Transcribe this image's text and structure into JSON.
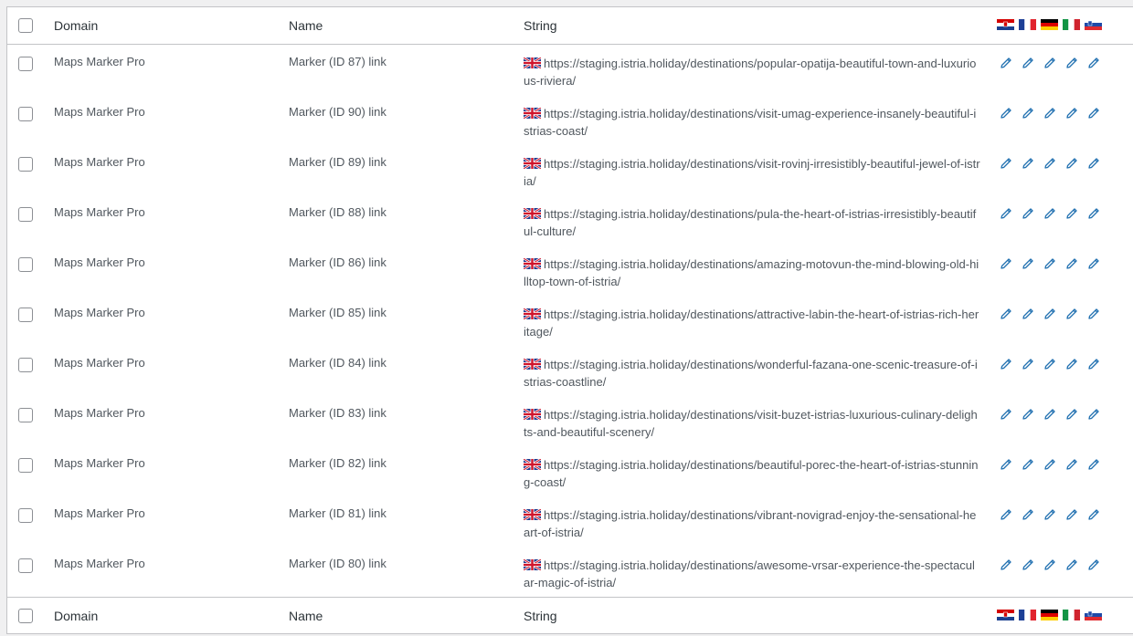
{
  "columns": {
    "domain": "Domain",
    "name": "Name",
    "string": "String"
  },
  "languages": [
    "hr-flag-icon",
    "fr-flag-icon",
    "de-flag-icon",
    "it-flag-icon",
    "si-flag-icon"
  ],
  "rows": [
    {
      "domain": "Maps Marker Pro",
      "name": "Marker (ID 87) link",
      "string": "https://staging.istria.holiday/destinations/popular-opatija-beautiful-town-and-luxurious-riviera/"
    },
    {
      "domain": "Maps Marker Pro",
      "name": "Marker (ID 90) link",
      "string": "https://staging.istria.holiday/destinations/visit-umag-experience-insanely-beautiful-istrias-coast/"
    },
    {
      "domain": "Maps Marker Pro",
      "name": "Marker (ID 89) link",
      "string": "https://staging.istria.holiday/destinations/visit-rovinj-irresistibly-beautiful-jewel-of-istria/"
    },
    {
      "domain": "Maps Marker Pro",
      "name": "Marker (ID 88) link",
      "string": "https://staging.istria.holiday/destinations/pula-the-heart-of-istrias-irresistibly-beautiful-culture/"
    },
    {
      "domain": "Maps Marker Pro",
      "name": "Marker (ID 86) link",
      "string": "https://staging.istria.holiday/destinations/amazing-motovun-the-mind-blowing-old-hilltop-town-of-istria/"
    },
    {
      "domain": "Maps Marker Pro",
      "name": "Marker (ID 85) link",
      "string": "https://staging.istria.holiday/destinations/attractive-labin-the-heart-of-istrias-rich-heritage/"
    },
    {
      "domain": "Maps Marker Pro",
      "name": "Marker (ID 84) link",
      "string": "https://staging.istria.holiday/destinations/wonderful-fazana-one-scenic-treasure-of-istrias-coastline/"
    },
    {
      "domain": "Maps Marker Pro",
      "name": "Marker (ID 83) link",
      "string": "https://staging.istria.holiday/destinations/visit-buzet-istrias-luxurious-culinary-delights-and-beautiful-scenery/"
    },
    {
      "domain": "Maps Marker Pro",
      "name": "Marker (ID 82) link",
      "string": "https://staging.istria.holiday/destinations/beautiful-porec-the-heart-of-istrias-stunning-coast/"
    },
    {
      "domain": "Maps Marker Pro",
      "name": "Marker (ID 81) link",
      "string": "https://staging.istria.holiday/destinations/vibrant-novigrad-enjoy-the-sensational-heart-of-istria/"
    },
    {
      "domain": "Maps Marker Pro",
      "name": "Marker (ID 80) link",
      "string": "https://staging.istria.holiday/destinations/awesome-vrsar-experience-the-spectacular-magic-of-istria/"
    }
  ],
  "colors": {
    "edit_icon": "#2271b1",
    "border": "#c3c4c7",
    "background": "#f0f0f1"
  }
}
